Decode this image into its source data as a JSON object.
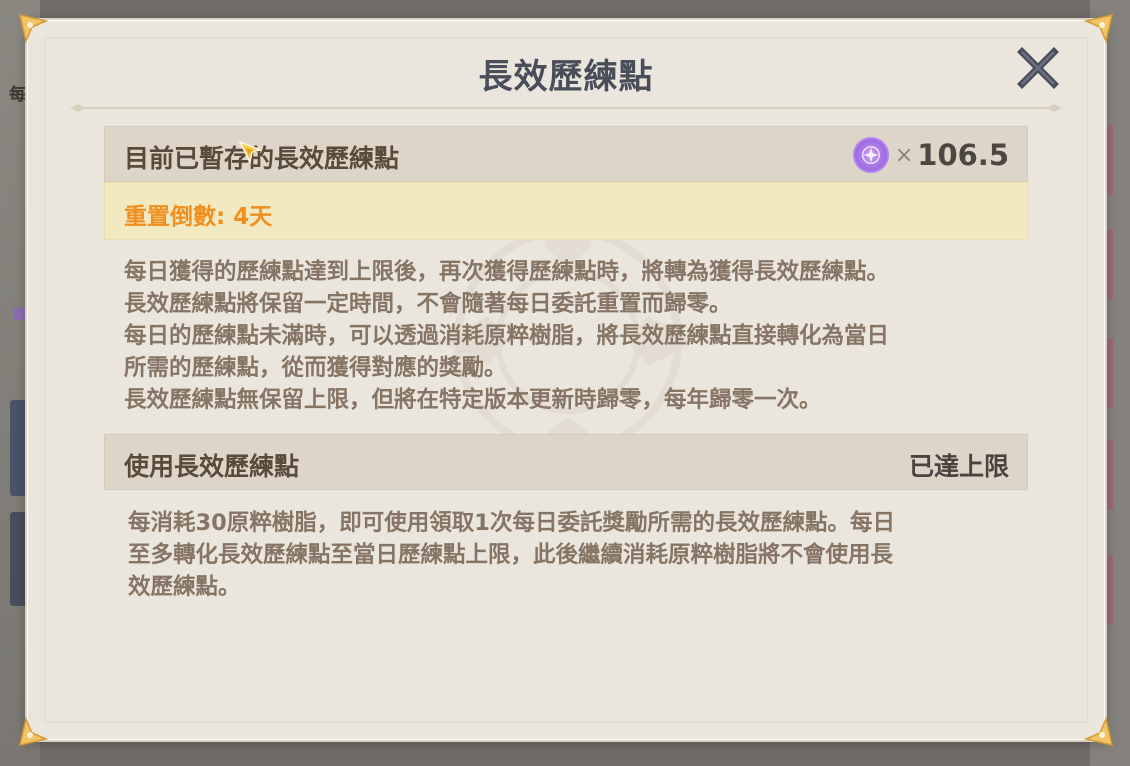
{
  "background": {
    "left_label": "每"
  },
  "dialog": {
    "title": "長效歷練點",
    "close_icon": "close-x-icon"
  },
  "stored_section": {
    "label": "目前已暫存的長效歷練點",
    "currency_icon": "purple-star-orb-icon",
    "times_symbol": "×",
    "amount": "106.5",
    "countdown": "重置倒數: 4天"
  },
  "stored_description": [
    "每日獲得的歷練點達到上限後，再次獲得歷練點時，將轉為獲得長效歷練點。",
    "長效歷練點將保留一定時間，不會隨著每日委託重置而歸零。",
    "每日的歷練點未滿時，可以透過消耗原粹樹脂，將長效歷練點直接轉化為當日",
    "所需的歷練點，從而獲得對應的獎勵。",
    "長效歷練點無保留上限，但將在特定版本更新時歸零，每年歸零一次。"
  ],
  "use_section": {
    "label": "使用長效歷練點",
    "status": "已達上限"
  },
  "use_description": [
    "每消耗30原粹樹脂，即可使用領取1次每日委託獎勵所需的長效歷練點。每日",
    "至多轉化長效歷練點至當日歷練點上限，此後繼續消耗原粹樹脂將不會使用長",
    "效歷練點。"
  ],
  "colors": {
    "title": "#4a4e5a",
    "countdown": "#ee8f1f",
    "description": "#867565",
    "orb": "#9b6ae0"
  }
}
